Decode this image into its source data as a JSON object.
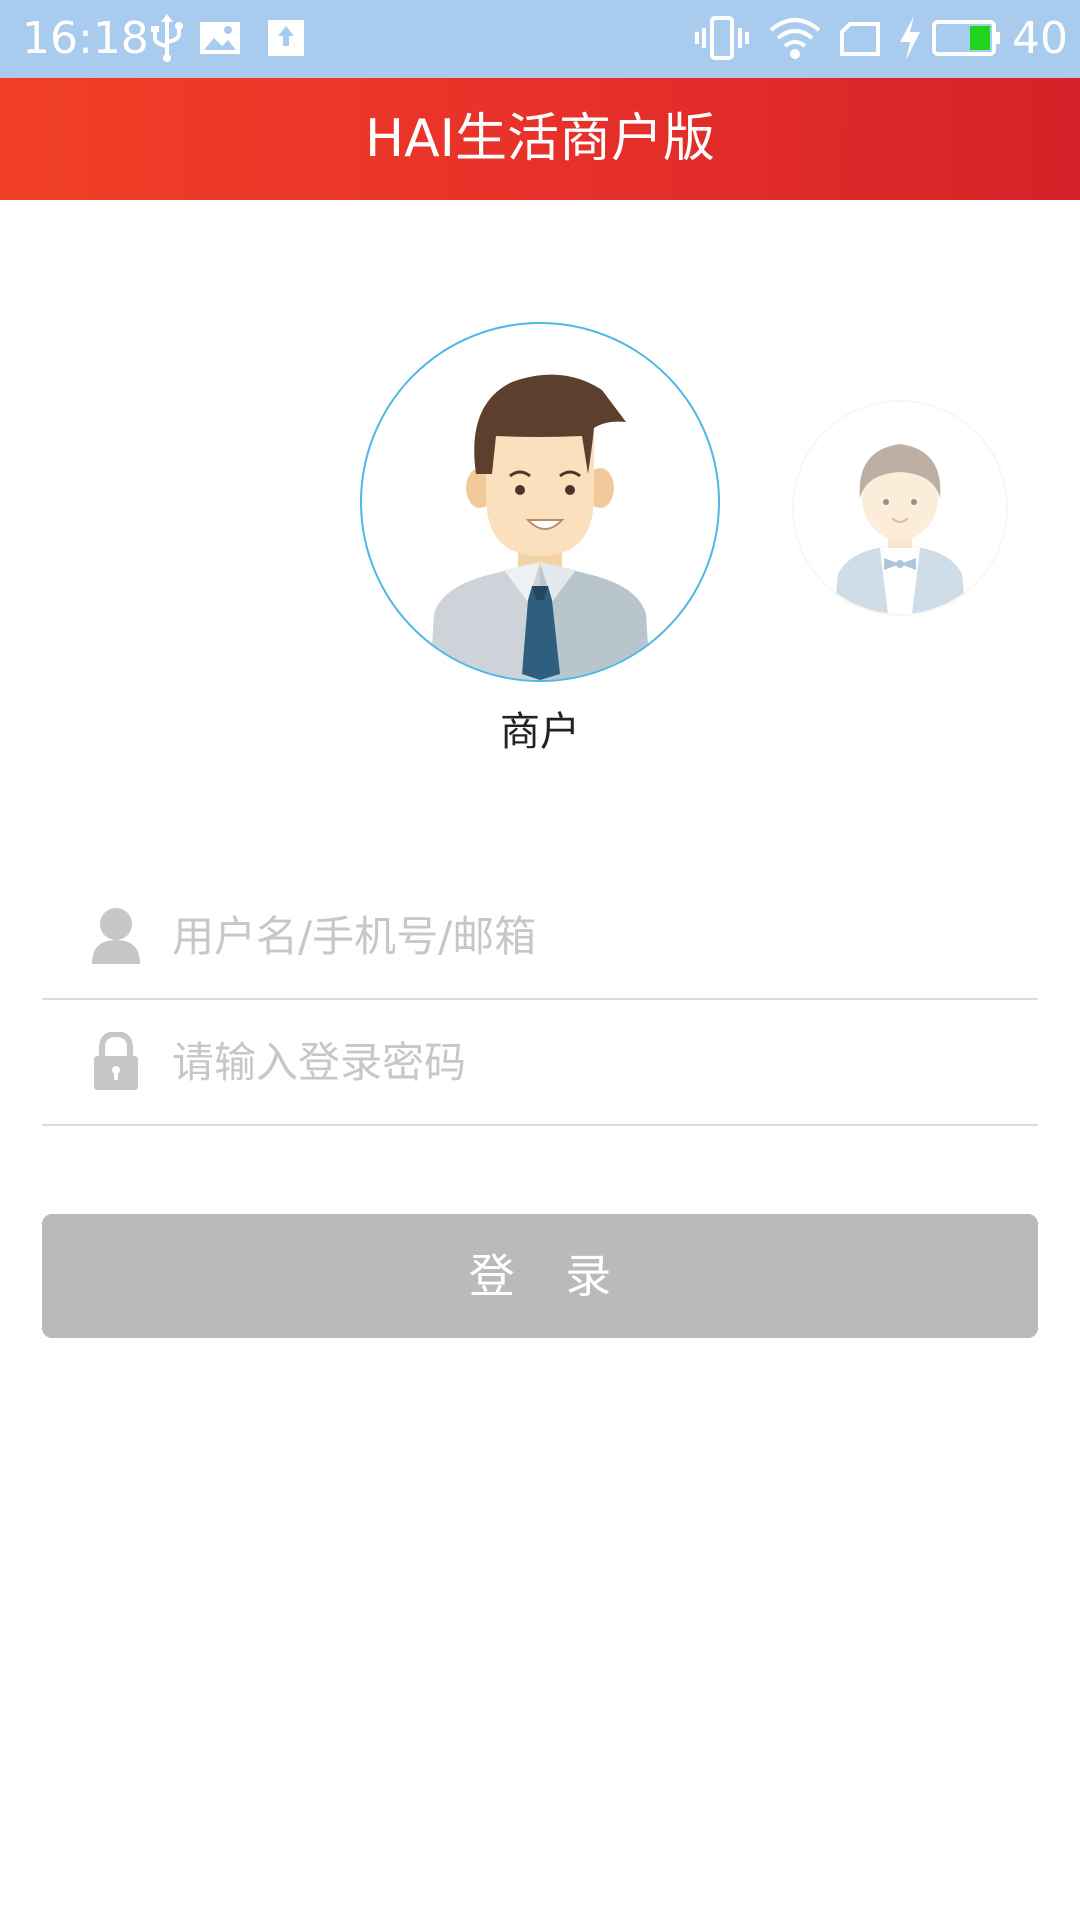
{
  "status_bar": {
    "time": "16:18",
    "battery_level": "40",
    "icons": [
      "usb-icon",
      "image-icon",
      "upload-icon",
      "vibrate-icon",
      "wifi-icon",
      "sim-icon",
      "charging-icon",
      "battery-icon"
    ]
  },
  "app_bar": {
    "title": "HAI生活商户版"
  },
  "roles": {
    "selected_label": "商户",
    "items": [
      "merchant-avatar",
      "staff-avatar"
    ]
  },
  "login_form": {
    "username_placeholder": "用户名/手机号/邮箱",
    "username_value": "",
    "password_placeholder": "请输入登录密码",
    "password_value": "",
    "login_label": "登 录"
  },
  "colors": {
    "status_bar": "#a9cbee",
    "app_bar_accent": "#e8312a",
    "avatar_ring": "#4db7e6",
    "button_disabled": "#bababa",
    "placeholder": "#c7c7c7",
    "divider": "#dddddd"
  }
}
